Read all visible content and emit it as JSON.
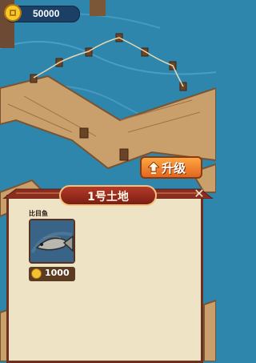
{
  "hud": {
    "coins": "50000"
  },
  "upgrade": {
    "label": "升级"
  },
  "panel": {
    "title": "1号土地",
    "close_icon": "close-icon"
  },
  "fish": {
    "name": "比目鱼",
    "price": "1000"
  },
  "colors": {
    "water": "#2f86ad",
    "panel_bg": "#efe3c6",
    "panel_border": "#6d2f1f",
    "plaque": "#b33a28",
    "upgrade_btn": "#ff8a2b"
  }
}
